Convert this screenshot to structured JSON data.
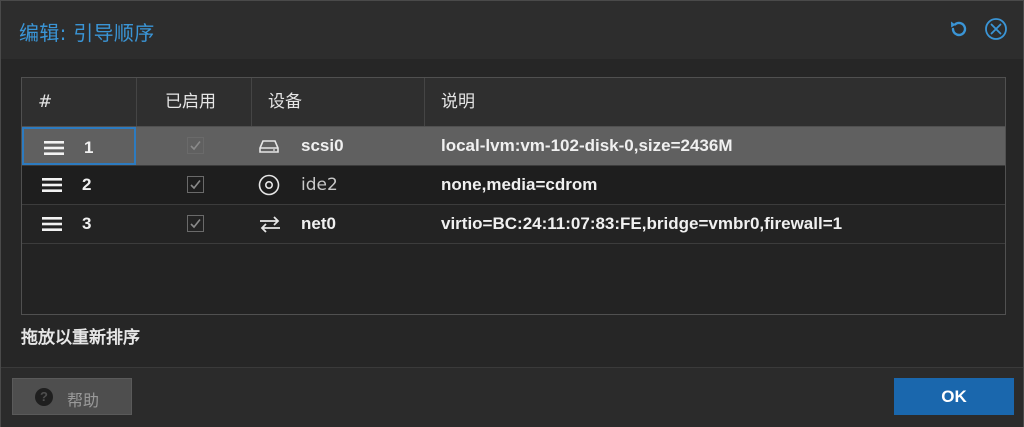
{
  "dialog": {
    "title": "编辑: 引导顺序",
    "reset_icon": "refresh-icon",
    "close_icon": "close-icon"
  },
  "grid": {
    "columns": [
      "#",
      "已启用",
      "设备",
      "说明"
    ],
    "rows": [
      {
        "num": "1",
        "enabled": true,
        "device_icon": "hard-disk-icon",
        "device": "scsi0",
        "description": "local-lvm:vm-102-disk-0,size=2436M",
        "selected": true
      },
      {
        "num": "2",
        "enabled": true,
        "device_icon": "cdrom-icon",
        "device": "ide2",
        "description": "none,media=cdrom",
        "selected": false
      },
      {
        "num": "3",
        "enabled": true,
        "device_icon": "network-exchange-icon",
        "device": "net0",
        "description": "virtio=BC:24:11:07:83:FE,bridge=vmbr0,firewall=1",
        "selected": false
      }
    ]
  },
  "hint": "拖放以重新排序",
  "footer": {
    "help_label": "帮助",
    "help_icon": "question-circle-icon",
    "ok_label": "OK"
  },
  "colors": {
    "accent": "#3a95d6",
    "ok_button": "#1a67ad",
    "selected_row": "#606060"
  }
}
